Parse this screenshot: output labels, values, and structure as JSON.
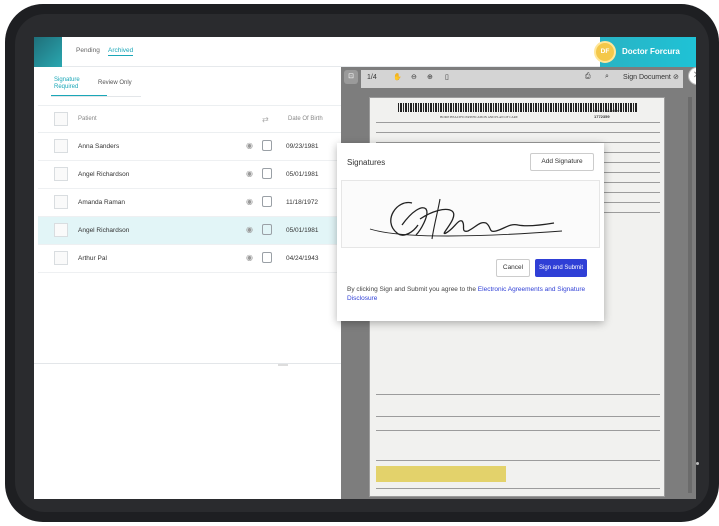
{
  "top_tabs": [
    "Pending",
    "Archived"
  ],
  "user": {
    "initials": "DF",
    "name": "Doctor Forcura"
  },
  "sub_tabs": {
    "signature_required": "Signature Required",
    "review_only": "Review Only"
  },
  "table": {
    "headers": {
      "patient": "Patient",
      "dob": "Date Of Birth"
    },
    "rows": [
      {
        "name": "Anna Sanders",
        "dob": "09/23/1981"
      },
      {
        "name": "Angel Richardson",
        "dob": "05/01/1981"
      },
      {
        "name": "Amanda Raman",
        "dob": "11/18/1972"
      },
      {
        "name": "Angel Richardson",
        "dob": "05/01/1981"
      },
      {
        "name": "Arthur Pal",
        "dob": "04/24/1943"
      }
    ],
    "selected_row": 3
  },
  "viewer": {
    "page": "1/4",
    "sign_document": "Sign Document"
  },
  "document": {
    "title": "HOME HEALTH CERTIFICATION AND PLAN OF CARE",
    "order_label": "Order Number:",
    "order_number": "1772359"
  },
  "modal": {
    "title": "Signatures",
    "add_signature": "Add Signature",
    "cancel": "Cancel",
    "sign_and_submit": "Sign and Submit",
    "disclaimer_prefix": "By clicking Sign and Submit you agree to the ",
    "disclaimer_link": "Electronic Agreements and Signature Disclosure"
  },
  "colors": {
    "accent": "#1aa7b8",
    "primary_button": "#2f3fd6",
    "selected_row": "#e2f5f7",
    "avatar": "#f4c84a"
  },
  "icons": [
    "filter-icon",
    "eye-icon",
    "print-icon",
    "hand-tool-icon",
    "zoom-out-icon",
    "zoom-in-icon",
    "fit-page-icon",
    "printer-icon",
    "search-icon",
    "close-icon"
  ]
}
